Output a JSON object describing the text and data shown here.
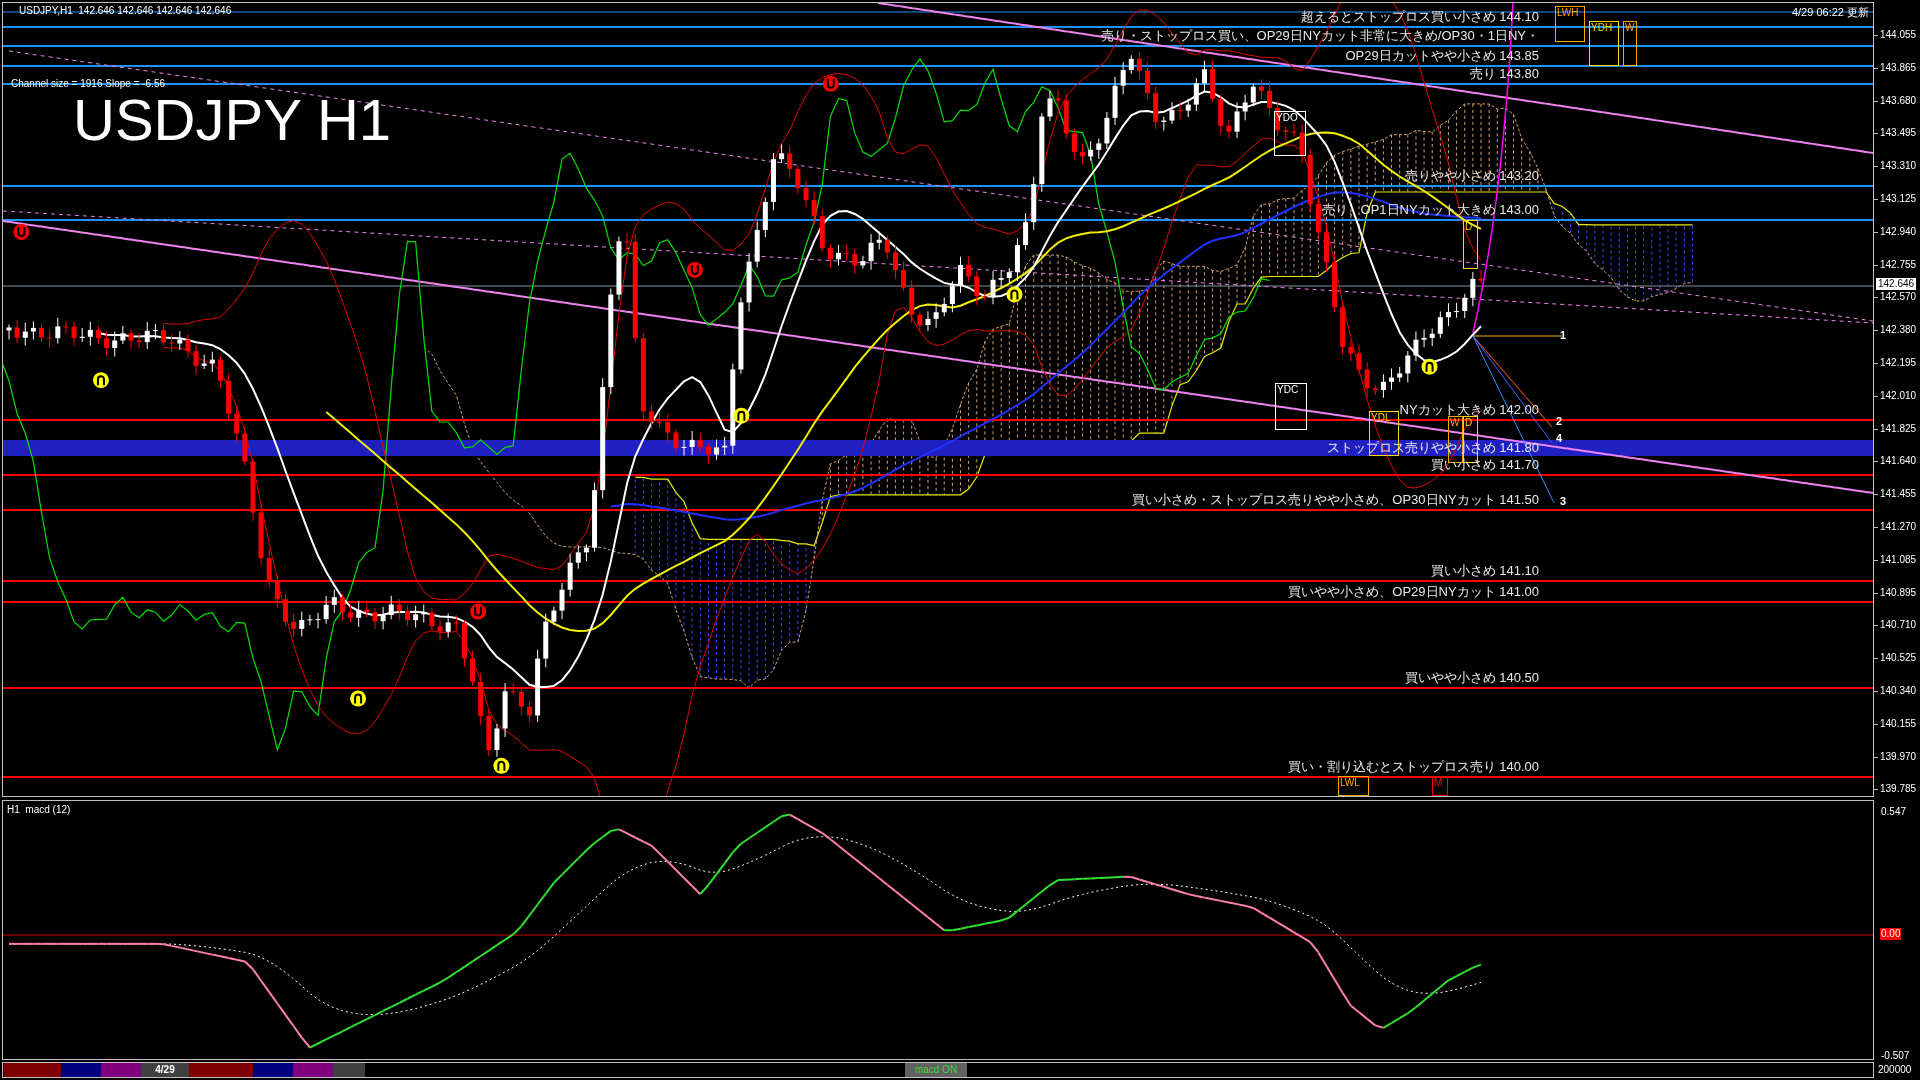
{
  "chart_header": {
    "symbol_line": "USDJPY,H1  142.646 142.646 142.646 142.646",
    "channel_info": "Channel size = 1916 Slope = -6.56",
    "title": "USDJPY H1",
    "updated": "4/29 06:22 更新"
  },
  "price_levels": [
    {
      "label": "超えるとストップロス買い小さめ 144.10",
      "color": "#1e90ff",
      "kind": "line"
    },
    {
      "label": "売り・ストップロス買い、OP29日NYカット非常に大きめ/OP30・1日NY・",
      "color": "#1e90ff",
      "kind": "line"
    },
    {
      "label": "OP29日カットやや小さめ 143.85",
      "color": "#1e90ff",
      "kind": "line"
    },
    {
      "label": "売り 143.80",
      "color": "#1e90ff",
      "kind": "line"
    },
    {
      "label": "売りやや小さめ 143.20",
      "color": "#1e90ff",
      "kind": "line"
    },
    {
      "label": "売り、OP1日NYカット大きめ 143.00",
      "color": "#1e90ff",
      "kind": "line"
    },
    {
      "label": "NYカット大きめ 142.00",
      "color": "#ff0000",
      "kind": "line"
    },
    {
      "label": "ストップロス売りやや小さめ 141.80",
      "color": "#2020c0",
      "kind": "band"
    },
    {
      "label": "買い小さめ 141.70",
      "color": "#ff0000",
      "kind": "line"
    },
    {
      "label": "買い小さめ・ストップロス売りやや小さめ、OP30日NYカット 141.50",
      "color": "#ff0000",
      "kind": "line"
    },
    {
      "label": "買い小さめ 141.10",
      "color": "#ff0000",
      "kind": "line"
    },
    {
      "label": "買いやや小さめ、OP29日NYカット 141.00",
      "color": "#ff0000",
      "kind": "line"
    },
    {
      "label": "買いやや小さめ 140.50",
      "color": "#ff0000",
      "kind": "line"
    },
    {
      "label": "買い・割り込むとストップロス売り 140.00",
      "color": "#ff0000",
      "kind": "line"
    }
  ],
  "markers": [
    {
      "label": "LWH",
      "color": "#ffa500"
    },
    {
      "label": "YDH",
      "color": "#ffd700"
    },
    {
      "label": "W",
      "color": "#ffa500"
    },
    {
      "label": "YDO",
      "color": "#ffffff"
    },
    {
      "label": "D",
      "color": "#ffd700"
    },
    {
      "label": "YDC",
      "color": "#ffffff"
    },
    {
      "label": "YDL",
      "color": "#ffd700"
    },
    {
      "label": "W",
      "color": "#ffa500"
    },
    {
      "label": "D",
      "color": "#ffd700"
    },
    {
      "label": "LWL",
      "color": "#ffa500"
    },
    {
      "label": "M",
      "color": "#ff0000"
    }
  ],
  "channel_numbers": [
    "1",
    "2",
    "4",
    "3"
  ],
  "price_axis": {
    "ticks": [
      "144.055",
      "143.865",
      "143.680",
      "143.495",
      "143.310",
      "143.125",
      "142.940",
      "142.755",
      "142.570",
      "142.380",
      "142.195",
      "142.010",
      "141.825",
      "141.640",
      "141.455",
      "141.270",
      "141.085",
      "140.895",
      "140.710",
      "140.525",
      "140.340",
      "140.155",
      "139.970",
      "139.785"
    ],
    "current_price": "142.646"
  },
  "macd_panel": {
    "title": "H1  macd (12)",
    "ticks": [
      "0.547",
      "0.00",
      "-0.507"
    ]
  },
  "bottom_bar": {
    "date_tab": "4/29",
    "macd_button": "macd ON",
    "volume_tick": "200000"
  }
}
